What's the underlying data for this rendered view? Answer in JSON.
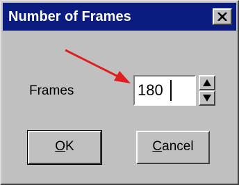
{
  "window": {
    "title": "Number of Frames",
    "close_icon": "close-icon"
  },
  "form": {
    "frames_label": "Frames",
    "frames_value": "180"
  },
  "buttons": {
    "ok": {
      "mnemonic": "O",
      "rest": "K"
    },
    "cancel": {
      "mnemonic": "C",
      "rest": "ancel"
    }
  },
  "colors": {
    "titlebar": "#0a1c80",
    "face": "#c0c0c0",
    "annotation_arrow": "#e01e1e"
  }
}
